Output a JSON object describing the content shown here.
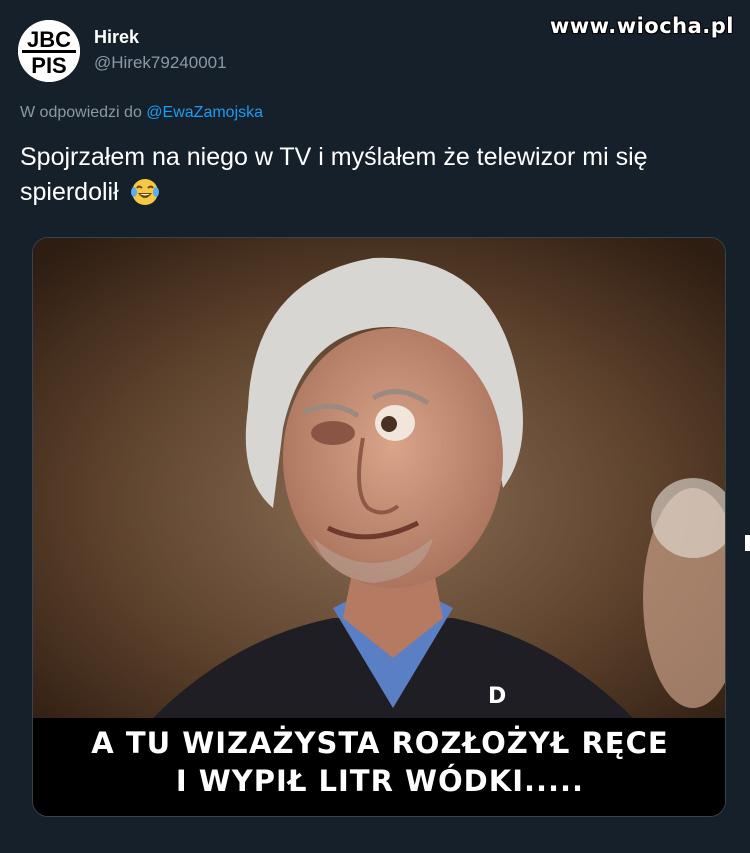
{
  "watermark": "www.wiocha.pl",
  "author": {
    "avatar_text_top": "JBC",
    "avatar_text_bottom": "PIS",
    "display_name": "Hirek",
    "handle": "@Hirek79240001"
  },
  "reply": {
    "prefix": "W odpowiedzi do",
    "mention": "@EwaZamojska"
  },
  "tweet": {
    "text": "Spojrzałem na niego w TV i myślałem że telewizor mi się spierdolił",
    "emoji": "face-with-tears-of-joy-icon"
  },
  "media": {
    "caption_line1": "A TU WIZAŻYSTA ROZŁOŻYŁ RĘCE",
    "caption_line2": "I WYPIŁ LITR WÓDKI.....",
    "photo_badge": "D"
  },
  "colors": {
    "background": "#15202b",
    "text": "#ffffff",
    "secondary": "#8b98a5",
    "link": "#1d9bf0"
  }
}
